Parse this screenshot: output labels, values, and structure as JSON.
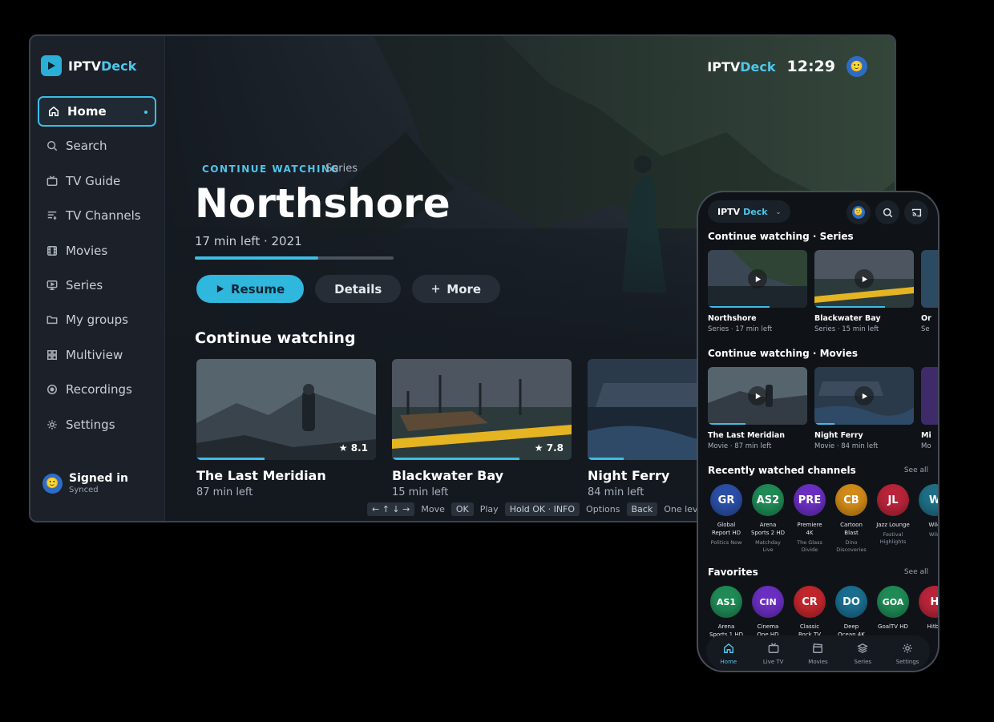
{
  "brand": {
    "name_a": "IPTV",
    "name_b": "Deck"
  },
  "sidebar": {
    "items": [
      {
        "label": "Home",
        "icon": "home-icon"
      },
      {
        "label": "Search",
        "icon": "search-icon"
      },
      {
        "label": "TV Guide",
        "icon": "tv-icon"
      },
      {
        "label": "TV Channels",
        "icon": "list-icon"
      },
      {
        "label": "Movies",
        "icon": "film-icon"
      },
      {
        "label": "Series",
        "icon": "monitor-icon"
      },
      {
        "label": "My groups",
        "icon": "folder-icon"
      },
      {
        "label": "Multiview",
        "icon": "grid-icon"
      },
      {
        "label": "Recordings",
        "icon": "record-icon"
      },
      {
        "label": "Settings",
        "icon": "gear-icon"
      }
    ],
    "signed_title": "Signed in",
    "signed_sub": "Synced"
  },
  "header": {
    "clock": "12:29"
  },
  "hero": {
    "eyebrow": "CONTINUE WATCHING",
    "kind": "Series",
    "title": "Northshore",
    "meta": "17 min left · 2021",
    "progress": 0.62,
    "buttons": {
      "resume": "Resume",
      "details": "Details",
      "more": "More"
    }
  },
  "continue": {
    "title": "Continue watching",
    "cards": [
      {
        "title": "The Last Meridian",
        "sub": "87 min left",
        "rating": "8.1",
        "progress": 0.38
      },
      {
        "title": "Blackwater Bay",
        "sub": "15 min left",
        "rating": "7.8",
        "progress": 0.71
      },
      {
        "title": "Night Ferry",
        "sub": "84 min left",
        "rating": "",
        "progress": 0.2
      }
    ]
  },
  "hints": {
    "keys": [
      "← ↑ ↓ →",
      "OK",
      "Hold OK · INFO",
      "Back"
    ],
    "move": "Move",
    "play": "Play",
    "options": "Options",
    "up": "One level up"
  },
  "phone": {
    "brand_a": "IPTV",
    "brand_b": "Deck",
    "sec_series": "Continue watching · Series",
    "series": [
      {
        "title": "Northshore",
        "sub": "Series · 17 min left",
        "progress": 0.62
      },
      {
        "title": "Blackwater Bay",
        "sub": "Series · 15 min left",
        "progress": 0.71
      },
      {
        "title": "Or",
        "sub": "Se",
        "progress": 0.3
      }
    ],
    "sec_movies": "Continue watching · Movies",
    "movies": [
      {
        "title": "The Last Meridian",
        "sub": "Movie · 87 min left",
        "progress": 0.38
      },
      {
        "title": "Night Ferry",
        "sub": "Movie · 84 min left",
        "progress": 0.2
      },
      {
        "title": "Mi",
        "sub": "Mo",
        "progress": 0.3
      }
    ],
    "sec_channels": "Recently watched channels",
    "see_all": "See all",
    "channels": [
      {
        "abbr": "GR",
        "name": "Global Report HD",
        "sub": "Politics Now",
        "color": "#2b4fa6"
      },
      {
        "abbr": "AS2",
        "name": "Arena Sports 2 HD",
        "sub": "Matchday Live",
        "color": "#1f8a55"
      },
      {
        "abbr": "PRE",
        "name": "Premiere 4K",
        "sub": "The Glass Divide",
        "color": "#6a2fc0"
      },
      {
        "abbr": "CB",
        "name": "Cartoon Blast",
        "sub": "Dino Discoveries",
        "color": "#d08a18"
      },
      {
        "abbr": "JL",
        "name": "Jazz Lounge",
        "sub": "Festival Highlights",
        "color": "#b8243a"
      },
      {
        "abbr": "W",
        "name": "Wild",
        "sub": "Wild",
        "color": "#1e6f86"
      }
    ],
    "sec_favorites": "Favorites",
    "favorites": [
      {
        "abbr": "AS1",
        "name": "Arena Sports 1 HD",
        "color": "#1f8a55"
      },
      {
        "abbr": "CIN",
        "name": "Cinema One HD",
        "color": "#6a2fc0"
      },
      {
        "abbr": "CR",
        "name": "Classic Rock TV",
        "color": "#c0262c"
      },
      {
        "abbr": "DO",
        "name": "Deep Ocean 4K",
        "color": "#1a6d8f"
      },
      {
        "abbr": "GOA",
        "name": "GoalTV HD",
        "color": "#1f8a55"
      },
      {
        "abbr": "H",
        "name": "Hitbo",
        "color": "#b8243a"
      }
    ],
    "tabs": [
      "Home",
      "Live TV",
      "Movies",
      "Series",
      "Settings"
    ]
  }
}
